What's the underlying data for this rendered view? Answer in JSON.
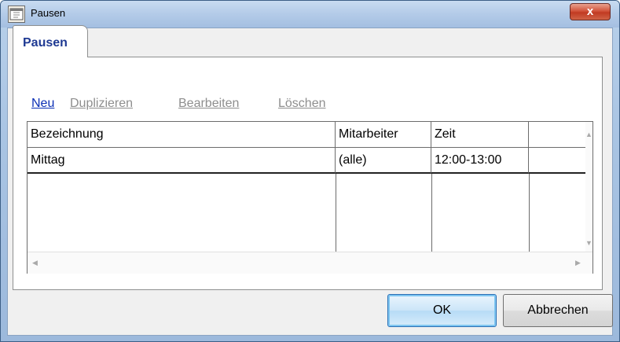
{
  "window": {
    "title": "Pausen",
    "close_glyph": "x"
  },
  "tabs": [
    {
      "label": "Pausen",
      "selected": true
    }
  ],
  "toolbar": {
    "new_label": "Neu",
    "duplicate_label": "Duplizieren",
    "edit_label": "Bearbeiten",
    "delete_label": "Löschen"
  },
  "table": {
    "columns": [
      "Bezeichnung",
      "Mitarbeiter",
      "Zeit",
      ""
    ],
    "rows": [
      [
        "Mittag",
        "(alle)",
        "12:00-13:00",
        ""
      ]
    ]
  },
  "buttons": {
    "ok_label": "OK",
    "cancel_label": "Abbrechen"
  },
  "icons": {
    "app": "calendar-icon",
    "close": "close-icon",
    "scroll_up": "scroll-up-arrow-icon",
    "scroll_down": "scroll-down-arrow-icon",
    "scroll_left": "scroll-left-arrow-icon",
    "scroll_right": "scroll-right-arrow-icon"
  },
  "colors": {
    "link_active": "#0b2fb5",
    "link_disabled": "#8e8e8e",
    "tab_label": "#1f3a93",
    "close_button": "#c13a22",
    "ok_border": "#2b6fb5"
  }
}
